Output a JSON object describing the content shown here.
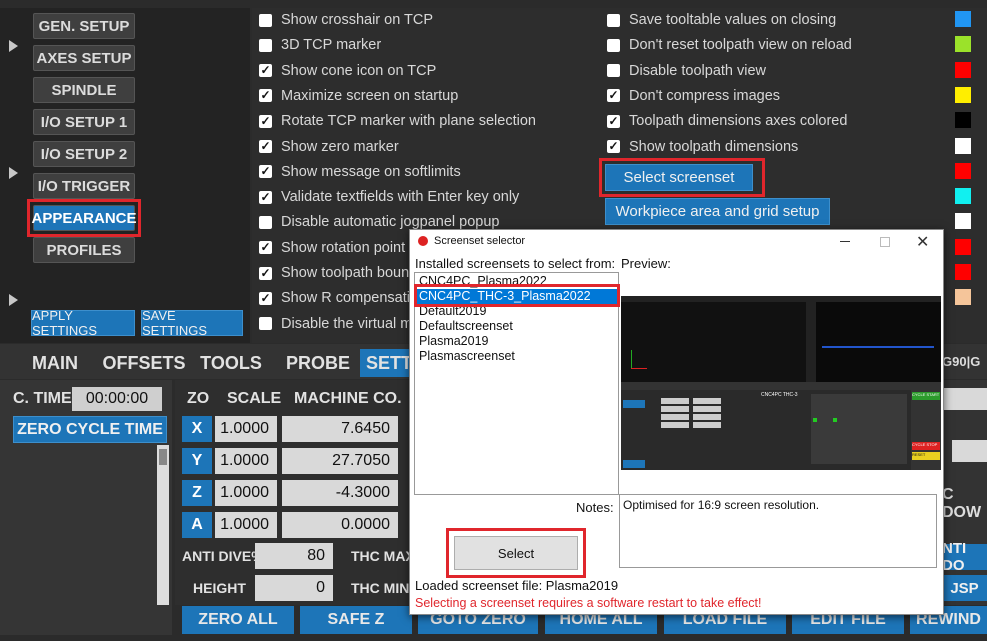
{
  "left_nav": {
    "items": [
      "GEN. SETUP",
      "AXES SETUP",
      "SPINDLE",
      "I/O SETUP 1",
      "I/O SETUP 2",
      "I/O TRIGGER",
      "APPEARANCE",
      "PROFILES"
    ],
    "apply": "APPLY SETTINGS",
    "save": "SAVE SETTINGS"
  },
  "options_left": [
    {
      "label": "Show crosshair on TCP",
      "checked": false
    },
    {
      "label": "3D TCP marker",
      "checked": false
    },
    {
      "label": "Show cone icon on TCP",
      "checked": true
    },
    {
      "label": "Maximize screen on startup",
      "checked": true
    },
    {
      "label": "Rotate TCP marker with plane selection",
      "checked": true
    },
    {
      "label": "Show zero marker",
      "checked": true
    },
    {
      "label": "Show message on softlimits",
      "checked": true
    },
    {
      "label": "Validate textfields with Enter key only",
      "checked": true
    },
    {
      "label": "Disable automatic jogpanel popup",
      "checked": false
    },
    {
      "label": "Show rotation point i",
      "checked": true
    },
    {
      "label": "Show toolpath bound",
      "checked": true
    },
    {
      "label": "Show R compensatio",
      "checked": true
    },
    {
      "label": "Disable the virtual m",
      "checked": false
    }
  ],
  "options_right": [
    {
      "label": "Save tooltable values on closing",
      "checked": false
    },
    {
      "label": "Don't reset toolpath view on reload",
      "checked": false
    },
    {
      "label": "Disable toolpath view",
      "checked": false
    },
    {
      "label": "Don't compress images",
      "checked": true
    },
    {
      "label": "Toolpath dimensions axes colored",
      "checked": true
    },
    {
      "label": "Show toolpath dimensions",
      "checked": true
    }
  ],
  "select_screenset_btn": "Select screenset",
  "workpiece_btn": "Workpiece area and grid setup",
  "swatches": [
    "#2196f3",
    "#9be22a",
    "#ff0000",
    "#ffee00",
    "#000000",
    "#ffffff",
    "#ff0000",
    "#11f0f0",
    "#ffffff",
    "#ff0000",
    "#ff0000",
    "#f5c59a"
  ],
  "tabs": [
    "MAIN",
    "OFFSETS",
    "TOOLS",
    "PROBE",
    "SETTI"
  ],
  "gcode_status": "G90|G",
  "ctime_label": "C. TIME:",
  "ctime_value": "00:00:00",
  "zero_cycle_time": "ZERO CYCLE TIME",
  "coord_headers": {
    "zo": "ZO",
    "scale": "SCALE",
    "machine": "MACHINE CO."
  },
  "axes": [
    {
      "name": "X",
      "scale": "1.0000",
      "machine": "7.6450"
    },
    {
      "name": "Y",
      "scale": "1.0000",
      "machine": "27.7050"
    },
    {
      "name": "Z",
      "scale": "1.0000",
      "machine": "-4.3000"
    },
    {
      "name": "A",
      "scale": "1.0000",
      "machine": "0.0000"
    }
  ],
  "anti_dive": {
    "label": "ANTI DIVE%",
    "value": "80"
  },
  "height": {
    "label": "HEIGHT",
    "value": "0"
  },
  "thc_max": "THC MAX.",
  "thc_min": "THC MIN.",
  "right_fragments": {
    "cdow": "C DOW",
    "nti_do": "NTI DO",
    "jsp": "JSP"
  },
  "bottom_buttons": [
    "ZERO ALL",
    "SAFE Z",
    "GOTO ZERO",
    "HOME ALL",
    "LOAD FILE",
    "EDIT FILE",
    "REWIND"
  ],
  "dialog": {
    "title": "Screenset selector",
    "installed_label": "Installed screensets to select from:",
    "preview_label": "Preview:",
    "list": [
      "CNC4PC_Plasma2022",
      "CNC4PC_THC-3_Plasma2022",
      "Default2019",
      "Defaultscreenset",
      "Plasma2019",
      "Plasmascreenset"
    ],
    "selected_index": 1,
    "notes_label": "Notes:",
    "notes_text": "Optimised for 16:9 screen resolution.",
    "select_btn": "Select",
    "loaded_text": "Loaded screenset file: Plasma2019",
    "restart_warning": "Selecting a screenset requires a software restart to take effect!",
    "preview": {
      "header_left": "CNC4PC THC-3",
      "tabs": [
        "MAIN",
        "OFFSETS",
        "TOOLS",
        "PROBE",
        "SETTINGS",
        "DIAG.",
        "CAM",
        "HELP"
      ],
      "cycle_start": "CYCLE START",
      "cycle_stop": "CYCLE STOP",
      "reset": "RESET"
    }
  }
}
